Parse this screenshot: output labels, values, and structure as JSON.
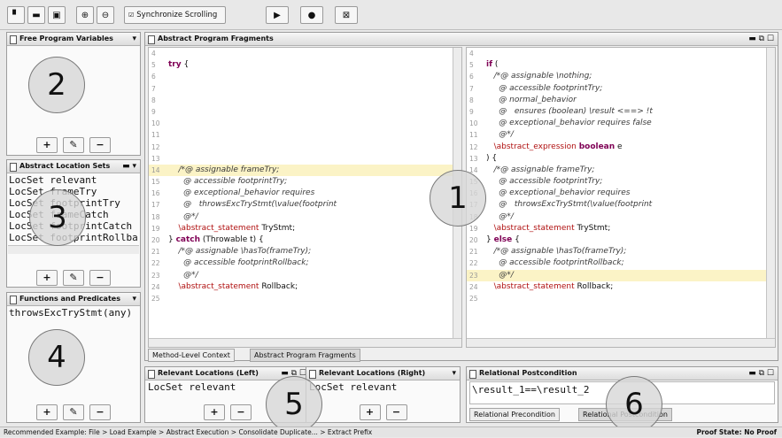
{
  "toolbar": {
    "new_icon": "new-file-icon",
    "open_icon": "open-folder-icon",
    "save_icon": "save-icon",
    "zoom_in_icon": "zoom-in-icon",
    "zoom_out_icon": "zoom-out-icon",
    "sync_scrolling_label": "Synchronize Scrolling",
    "play_icon": "play-icon",
    "record_icon": "record-icon",
    "stop_icon": "stop-icon"
  },
  "free_vars": {
    "title": "Free Program Variables"
  },
  "location_sets": {
    "title": "Abstract Location Sets",
    "items": [
      "LocSet relevant",
      "LocSet frameTry",
      "LocSet footprintTry",
      "LocSet frameCatch",
      "LocSet footprintCatch",
      "LocSet footprintRollba"
    ]
  },
  "functions": {
    "title": "Functions and Predicates",
    "items": [
      "throwsExcTryStmt(any)"
    ]
  },
  "fragments": {
    "title": "Abstract Program Fragments",
    "left_numbers": [
      "4",
      "5",
      "6",
      "7",
      "8",
      "9",
      "10",
      "11",
      "12",
      "13",
      "14",
      "15",
      "16",
      "17",
      "18",
      "19",
      "20",
      "21",
      "22",
      "23",
      "24",
      "25"
    ],
    "right_numbers": [
      "4",
      "5",
      "6",
      "7",
      "8",
      "9",
      "10",
      "11",
      "12",
      "13",
      "14",
      "15",
      "16",
      "17",
      "18",
      "19",
      "20",
      "21",
      "22",
      "23",
      "24",
      "25"
    ],
    "left_lines": [
      "",
      "try {",
      "",
      "",
      "",
      "",
      "",
      "",
      "",
      "",
      "    /*@ assignable frameTry;",
      "      @ accessible footprintTry;",
      "      @ exceptional_behavior requires",
      "      @   throwsExcTryStmt(\\value(footprint",
      "      @*/",
      "    \\abstract_statement TryStmt;",
      "} catch (Throwable t) {",
      "    /*@ assignable \\hasTo(frameTry);",
      "      @ accessible footprintRollback;",
      "      @*/",
      "    \\abstract_statement Rollback;",
      ""
    ],
    "right_lines": [
      "",
      "if (",
      "   /*@ assignable \\nothing;",
      "     @ accessible footprintTry;",
      "     @ normal_behavior",
      "     @   ensures (boolean) \\result <==> !t",
      "     @ exceptional_behavior requires false",
      "     @*/",
      "   \\abstract_expression boolean e",
      ") {",
      "   /*@ assignable frameTry;",
      "     @ accessible footprintTry;",
      "     @ exceptional_behavior requires",
      "     @   throwsExcTryStmt(\\value(footprint",
      "     @*/",
      "   \\abstract_statement TryStmt;",
      "} else {",
      "   /*@ assignable \\hasTo(frameTry);",
      "     @ accessible footprintRollback;",
      "     @*/",
      "   \\abstract_statement Rollback;",
      ""
    ],
    "tab_method": "Method-Level Context",
    "tab_fragments": "Abstract Program Fragments"
  },
  "relevant_left": {
    "title": "Relevant Locations (Left)",
    "item": "LocSet relevant"
  },
  "relevant_right": {
    "title": "Relevant Locations (Right)",
    "item": "LocSet relevant"
  },
  "postcondition": {
    "title": "Relational Postcondition",
    "text": "\\result_1==\\result_2",
    "tab_pre": "Relational Precondition",
    "tab_post": "Relational Postcondition"
  },
  "callouts": [
    "1",
    "2",
    "3",
    "4",
    "5",
    "6"
  ],
  "status": {
    "left": "Recommended Example: File > Load Example > Abstract Execution > Consolidate Duplicate... > Extract Prefix",
    "right": "Proof State: No Proof"
  },
  "button_labels": {
    "add": "+",
    "edit": "✎",
    "remove": "−"
  }
}
